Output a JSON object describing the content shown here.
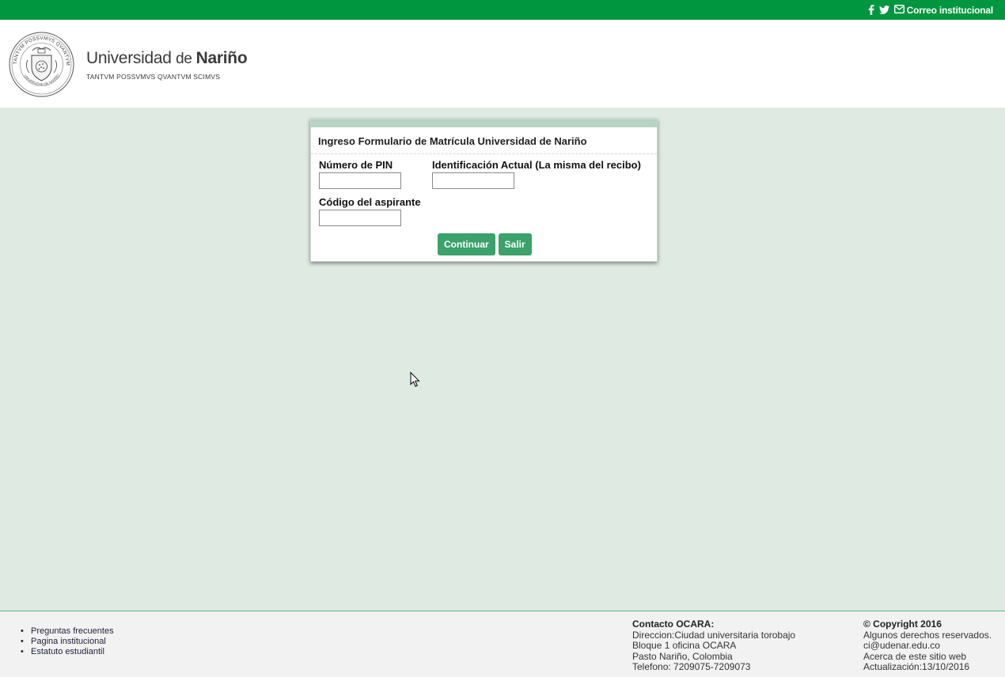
{
  "colors": {
    "topbar": "#00963f",
    "main_bg": "#dfebe2",
    "button": "#3aa26a",
    "panel_header": "#b6d3c3"
  },
  "topbar": {
    "icons": [
      "facebook-icon",
      "twitter-icon",
      "mail-icon"
    ],
    "mail_link": "Correo institucional"
  },
  "header": {
    "brand_prefix": "Universidad ",
    "brand_de": "de ",
    "brand_bold": "Nariño",
    "motto": "TANTVM POSSVMVS QVANTVM SCIMVS",
    "seal_top_text": "TANTVM POSSVMVS QVANTVM SCIMVS",
    "seal_bottom_text": "UNIVERSIDAD DE NARIÑO"
  },
  "form": {
    "title": "Ingreso Formulario de Matrícula Universidad de Nariño",
    "pin_label": "Número de PIN",
    "pin_value": "",
    "id_label": "Identificación Actual (La misma del recibo)",
    "id_value": "",
    "code_label": "Código del aspirante",
    "code_value": "",
    "continue_label": "Continuar",
    "exit_label": "Salir"
  },
  "footer": {
    "links": [
      "Preguntas frecuentes",
      "Pagina institucional",
      "Estatuto estudiantil"
    ],
    "contact_title": "Contacto OCARA:",
    "contact_lines": [
      "Direccion:Ciudad universitaria torobajo",
      "Bloque 1 oficina OCARA",
      "Pasto Nariño, Colombia",
      "Telefono: 7209075-7209073"
    ],
    "copyright_title": "© Copyright 2016",
    "copyright_lines": [
      "Algunos derechos reservados.",
      "ci@udenar.edu.co",
      "Acerca de este sitio web",
      "Actualización:13/10/2016"
    ]
  }
}
